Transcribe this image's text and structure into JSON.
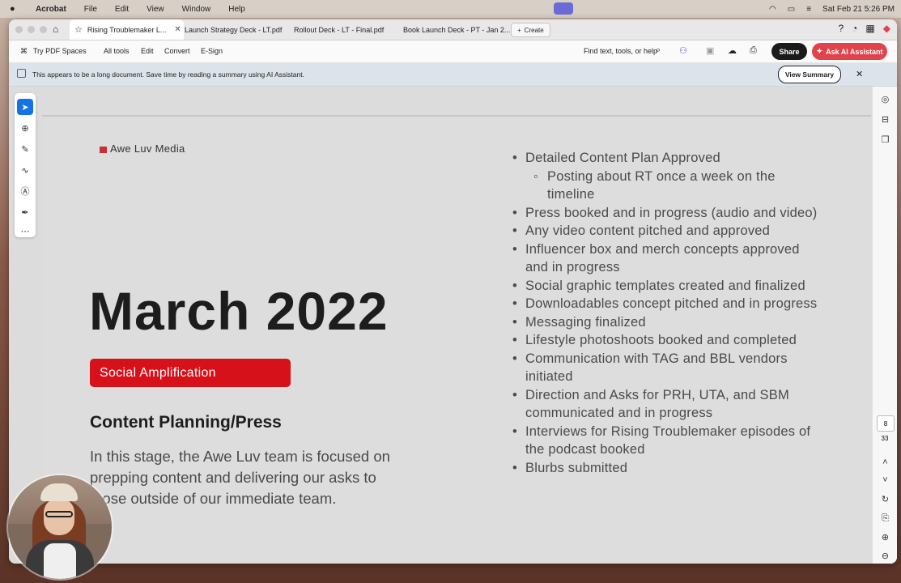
{
  "menubar": {
    "app": "Acrobat",
    "items": [
      "File",
      "Edit",
      "View",
      "Window",
      "Help"
    ],
    "datetime": "Sat Feb 21  5:26 PM"
  },
  "tabs": [
    {
      "label": "Rising Troublemaker L...",
      "active": true
    },
    {
      "label": "Launch Strategy Deck - LT.pdf",
      "active": false
    },
    {
      "label": "Rollout Deck - LT - Final.pdf",
      "active": false
    },
    {
      "label": "Book Launch Deck - PT - Jan 2...",
      "active": false
    }
  ],
  "create_label": "Create",
  "toolbar": {
    "spaces": "Try PDF Spaces",
    "all_tools": "All tools",
    "edit": "Edit",
    "convert": "Convert",
    "esign": "E-Sign",
    "find": "Find text, tools, or help",
    "share": "Share",
    "ai": "Ask AI Assistant"
  },
  "banner": {
    "text": "This appears to be a long document. Save time by reading a summary using AI Assistant.",
    "button": "View Summary"
  },
  "page": {
    "logo": "Awe Luv Media",
    "title": "March 2022",
    "pill": "Social Amplification",
    "subhead": "Content Planning/Press",
    "body": "In this stage, the Awe Luv team is focused on prepping content and delivering our asks to those outside of our immediate team.",
    "bullets": [
      {
        "text": "Detailed Content Plan Approved",
        "sub": false
      },
      {
        "text": "Posting about RT once a week on the timeline",
        "sub": true
      },
      {
        "text": "Press booked and in progress (audio and video)",
        "sub": false
      },
      {
        "text": "Any video content pitched and approved",
        "sub": false
      },
      {
        "text": "Influencer box and merch concepts approved and in progress",
        "sub": false
      },
      {
        "text": "Social graphic templates created and finalized",
        "sub": false
      },
      {
        "text": "Downloadables concept pitched and in progress",
        "sub": false
      },
      {
        "text": "Messaging finalized",
        "sub": false
      },
      {
        "text": "Lifestyle photoshoots booked and completed",
        "sub": false
      },
      {
        "text": "Communication with TAG and BBL vendors initiated",
        "sub": false
      },
      {
        "text": "Direction and Asks for PRH, UTA, and SBM communicated and in progress",
        "sub": false
      },
      {
        "text": "Interviews for Rising Troublemaker episodes of the podcast booked",
        "sub": false
      },
      {
        "text": "Blurbs submitted",
        "sub": false
      }
    ]
  },
  "page_indicator": {
    "current": "8",
    "total": "33"
  },
  "colors": {
    "accent": "#1473e6",
    "pill": "#d7111a",
    "ai_button": "#e0434b"
  }
}
